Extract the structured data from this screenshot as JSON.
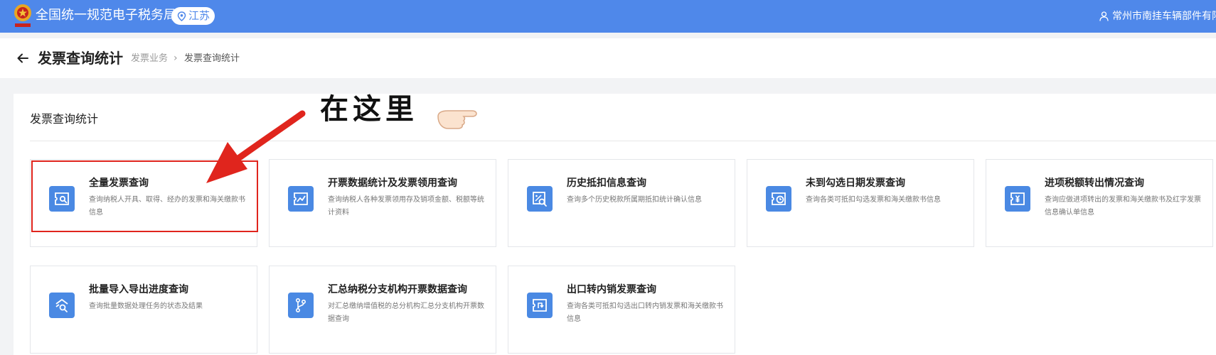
{
  "header": {
    "site_title": "全国统一规范电子税务局",
    "region": "江苏",
    "user_name": "常州市南挂车辆部件有限公"
  },
  "page": {
    "title": "发票查询统计",
    "breadcrumb": [
      "发票业务",
      "发票查询统计"
    ]
  },
  "panel": {
    "title": "发票查询统计"
  },
  "annotation": {
    "text": "在这里"
  },
  "colors": {
    "topbar": "#4f88ea",
    "icon_bg": "#4a89e3",
    "highlight": "#e0251d"
  },
  "cards": [
    {
      "title": "全量发票查询",
      "desc": "查询纳税人开具、取得、经办的发票和海关缴款书信息",
      "icon": "invoice-search-icon"
    },
    {
      "title": "开票数据统计及发票领用查询",
      "desc": "查询纳税人各种发票领用存及销项金额、税额等统计资料",
      "icon": "invoice-trend-icon"
    },
    {
      "title": "历史抵扣信息查询",
      "desc": "查询多个历史税款所属期抵扣统计确认信息",
      "icon": "deduction-search-icon"
    },
    {
      "title": "未到勾选日期发票查询",
      "desc": "查询各类可抵扣勾选发票和海关缴款书信息",
      "icon": "invoice-clock-icon"
    },
    {
      "title": "进项税额转出情况查询",
      "desc": "查询应做进项转出的发票和海关缴款书及红字发票信息确认单信息",
      "icon": "invoice-yen-icon"
    },
    {
      "title": "批量导入导出进度查询",
      "desc": "查询批量数据处理任务的状态及结果",
      "icon": "batch-search-icon"
    },
    {
      "title": "汇总纳税分支机构开票数据查询",
      "desc": "对汇总缴纳增值税的总分机构汇总分支机构开票数据查询",
      "icon": "branch-icon"
    },
    {
      "title": "出口转内销发票查询",
      "desc": "查询各类可抵扣勾选出口转内销发票和海关缴款书信息",
      "icon": "export-invoice-icon"
    }
  ]
}
